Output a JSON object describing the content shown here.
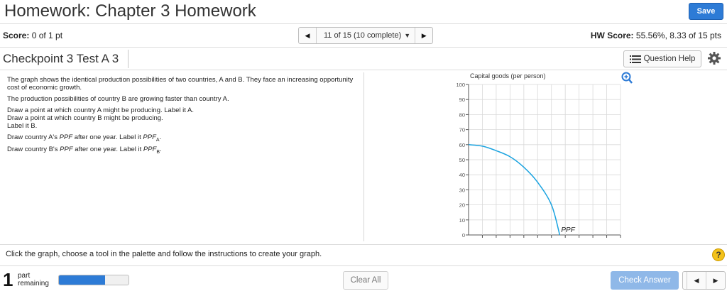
{
  "header": {
    "title": "Homework: Chapter 3 Homework",
    "save_label": "Save"
  },
  "score": {
    "label": "Score:",
    "value": "0 of 1 pt"
  },
  "nav": {
    "current": "11 of 15 (10 complete)"
  },
  "hw_score": {
    "label": "HW Score:",
    "value": "55.56%, 8.33 of 15 pts"
  },
  "question": {
    "title": "Checkpoint 3 Test A 3",
    "help_label": "Question Help"
  },
  "instructions": {
    "p1": "The graph shows the identical production possibilities of two countries, A and B. They face an increasing opportunity cost of economic growth.",
    "p2": "The production possibilities of country B are growing faster than country A.",
    "p3a": "Draw a point at which country A might be producing. Label it A.",
    "p3b": "Draw a point at which country B might be producing.",
    "p3c": "Label it B.",
    "p4_pre": "Draw country A's ",
    "p4_mid": " after one year. Label it ",
    "p5_pre": "Draw country B's ",
    "p5_mid": " after one year. Label it ",
    "ppf": "PPF",
    "sub_a": "A",
    "sub_b": "B",
    "period": "."
  },
  "chart_data": {
    "type": "line",
    "ylabel": "Capital goods (per person)",
    "ylim": [
      0,
      100
    ],
    "yticks": [
      "100",
      "90",
      "80",
      "70",
      "60",
      "50",
      "40",
      "30",
      "20",
      "10",
      "0"
    ],
    "series": [
      {
        "name": "PPF",
        "color": "#1aa3e0",
        "points": [
          [
            0,
            60
          ],
          [
            1,
            59
          ],
          [
            2,
            56
          ],
          [
            3,
            52
          ],
          [
            4,
            45
          ],
          [
            5,
            35
          ],
          [
            6,
            20
          ],
          [
            6.6,
            0
          ]
        ]
      }
    ],
    "annotation": "PPF"
  },
  "footer": {
    "click_info": "Click the graph, choose a tool in the palette and follow the instructions to create your graph.",
    "help_symbol": "?",
    "parts_num": "1",
    "parts_label_1": "part",
    "parts_label_2": "remaining",
    "progress_fraction": 0.66,
    "clear_label": "Clear All",
    "check_label": "Check Answer"
  },
  "colors": {
    "accent": "#2d7bd6",
    "curve": "#1aa3e0",
    "help": "#f3c21b"
  }
}
